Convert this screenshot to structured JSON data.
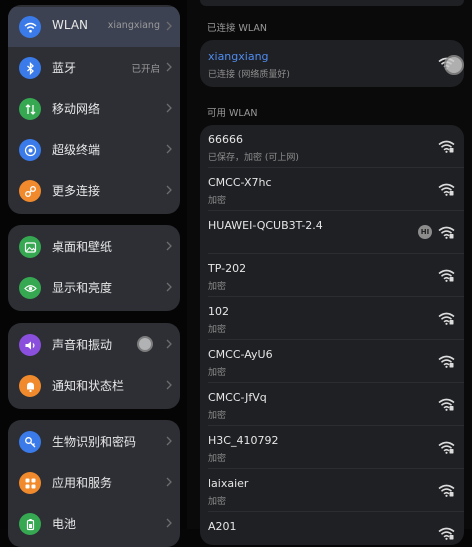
{
  "sidebar": {
    "groups": [
      [
        {
          "label": "WLAN",
          "value": "xiangxiang",
          "icon": "wifi-icon",
          "color": "#3a7be9",
          "selected": true
        },
        {
          "label": "蓝牙",
          "value": "已开启",
          "icon": "bluetooth-icon",
          "color": "#3a7be9"
        },
        {
          "label": "移动网络",
          "value": "",
          "icon": "mobile-network-icon",
          "color": "#36a852"
        },
        {
          "label": "超级终端",
          "value": "",
          "icon": "super-device-icon",
          "color": "#3a7be9"
        },
        {
          "label": "更多连接",
          "value": "",
          "icon": "more-connections-icon",
          "color": "#f08a2c"
        }
      ],
      [
        {
          "label": "桌面和壁纸",
          "value": "",
          "icon": "wallpaper-icon",
          "color": "#36a852"
        },
        {
          "label": "显示和亮度",
          "value": "",
          "icon": "display-icon",
          "color": "#36a852"
        }
      ],
      [
        {
          "label": "声音和振动",
          "value": "",
          "icon": "sound-icon",
          "color": "#8a4fdc"
        },
        {
          "label": "通知和状态栏",
          "value": "",
          "icon": "notification-icon",
          "color": "#f08a2c"
        }
      ],
      [
        {
          "label": "生物识别和密码",
          "value": "",
          "icon": "key-icon",
          "color": "#3a7be9"
        },
        {
          "label": "应用和服务",
          "value": "",
          "icon": "apps-icon",
          "color": "#f08a2c"
        },
        {
          "label": "电池",
          "value": "",
          "icon": "battery-icon",
          "color": "#36a852"
        }
      ]
    ]
  },
  "wlan": {
    "connected_header": "已连接 WLAN",
    "connected": {
      "name": "xiangxiang",
      "status": "已连接 (网络质量好)"
    },
    "available_header": "可用 WLAN",
    "networks": [
      {
        "name": "66666",
        "status": "已保存，加密 (可上网)",
        "badge": ""
      },
      {
        "name": "CMCC-X7hc",
        "status": "加密",
        "badge": ""
      },
      {
        "name": "HUAWEI-QCUB3T-2.4",
        "status": "",
        "badge": "HI"
      },
      {
        "name": "TP-202",
        "status": "加密",
        "badge": ""
      },
      {
        "name": "102",
        "status": "加密",
        "badge": ""
      },
      {
        "name": "CMCC-AyU6",
        "status": "加密",
        "badge": ""
      },
      {
        "name": "CMCC-JfVq",
        "status": "加密",
        "badge": ""
      },
      {
        "name": "H3C_410792",
        "status": "加密",
        "badge": ""
      },
      {
        "name": "laixaier",
        "status": "加密",
        "badge": ""
      },
      {
        "name": "A201",
        "status": "",
        "badge": ""
      }
    ]
  },
  "colors": {
    "accent": "#4f8cf0",
    "selected_row": "#3c4252"
  }
}
